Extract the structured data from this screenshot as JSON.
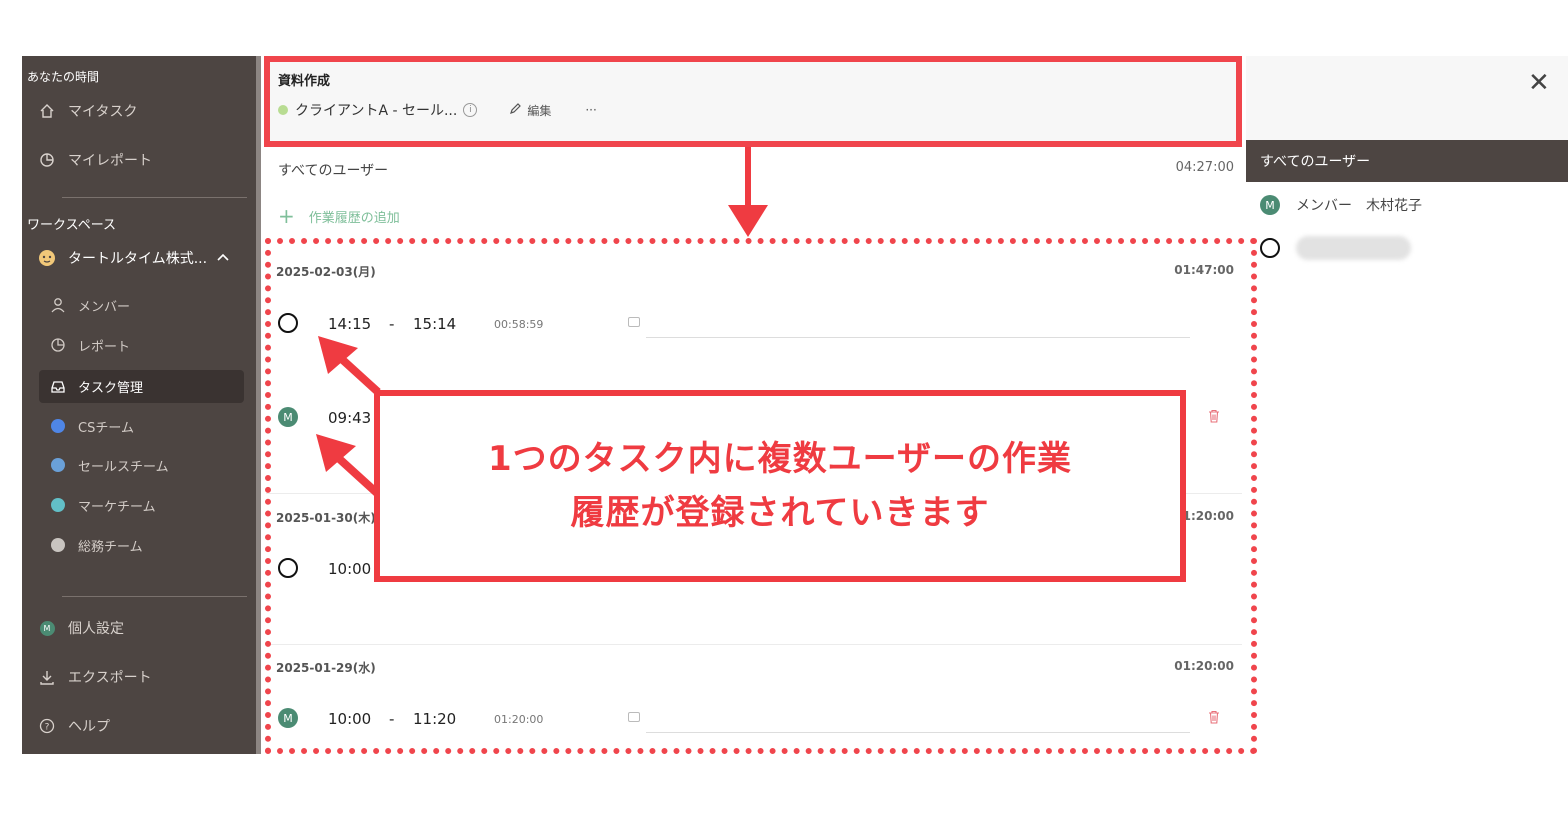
{
  "sidebar": {
    "section_time": "あなたの時間",
    "my_task": "マイタスク",
    "my_report": "マイレポート",
    "section_workspace": "ワークスペース",
    "workspace_name": "タートルタイム株式...",
    "members": "メンバー",
    "report": "レポート",
    "task_management": "タスク管理",
    "team_cs": "CSチーム",
    "team_sales": "セールスチーム",
    "team_marketing": "マーケチーム",
    "team_general": "総務チーム",
    "personal_settings": "個人設定",
    "export": "エクスポート",
    "help": "ヘルプ"
  },
  "task": {
    "title": "資料作成",
    "project": "クライアントA - セール...",
    "edit_label": "編集",
    "more_label": "···"
  },
  "main": {
    "all_users_label": "すべてのユーザー",
    "all_users_total": "04:27:00",
    "add_history_label": "作業履歴の追加"
  },
  "days": [
    {
      "date": "2025-02-03(月)",
      "total": "01:47:00",
      "entries": [
        {
          "start": "14:15",
          "dash": "-",
          "end": "15:14",
          "duration": "00:58:59"
        },
        {
          "start": "09:43"
        }
      ]
    },
    {
      "date": "2025-01-30(木)",
      "total": "01:20:00",
      "entries": [
        {
          "start": "10:00"
        }
      ]
    },
    {
      "date": "2025-01-29(水)",
      "total": "01:20:00",
      "entries": [
        {
          "start": "10:00",
          "dash": "-",
          "end": "11:20",
          "duration": "01:20:00"
        }
      ]
    }
  ],
  "right_panel": {
    "close_label": "✕",
    "header": "すべてのユーザー",
    "users": [
      {
        "avatar": "M",
        "role": "メンバー",
        "name": "木村花子"
      }
    ]
  },
  "annotation": {
    "line1": "1つのタスク内に複数ユーザーの作業",
    "line2": "履歴が登録されていきます"
  },
  "colors": {
    "annotation_red": "#ef3b41",
    "sidebar_bg": "#4d4542",
    "member_avatar": "#4b8b73",
    "add_green": "#7fbf9a",
    "trash_red": "#e8717a"
  },
  "avatar_letter": "M"
}
